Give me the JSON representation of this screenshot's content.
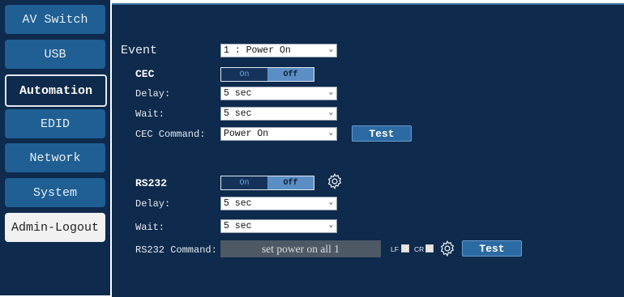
{
  "sidebar": {
    "items": [
      {
        "label": "AV Switch"
      },
      {
        "label": "USB"
      },
      {
        "label": "Automation"
      },
      {
        "label": "EDID"
      },
      {
        "label": "Network"
      },
      {
        "label": "System"
      },
      {
        "label": "Admin-Logout"
      }
    ],
    "active": "Automation"
  },
  "event": {
    "label": "Event",
    "value": "1 : Power On"
  },
  "cec": {
    "title": "CEC",
    "toggle_on": "On",
    "toggle_off": "Off",
    "toggle_state": "Off",
    "delay_label": "Delay:",
    "delay_value": "5 sec",
    "wait_label": "Wait:",
    "wait_value": "5 sec",
    "command_label": "CEC Command:",
    "command_value": "Power On",
    "test_label": "Test"
  },
  "rs232": {
    "title": "RS232",
    "toggle_on": "On",
    "toggle_off": "Off",
    "toggle_state": "Off",
    "delay_label": "Delay:",
    "delay_value": "5 sec",
    "wait_label": "Wait:",
    "wait_value": "5 sec",
    "command_label": "RS232 Command:",
    "command_value": "set power on all 1",
    "lf_label": "LF",
    "cr_label": "CR",
    "test_label": "Test"
  },
  "colors": {
    "panel_bg": "#0e2a4c",
    "nav_button": "#1f5f94",
    "toggle_selected": "#5b8ec4",
    "test_button": "#2b6aa3"
  }
}
